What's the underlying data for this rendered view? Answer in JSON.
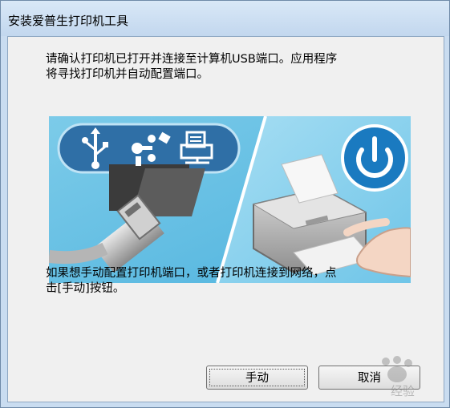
{
  "window": {
    "title": "安装爱普生打印机工具"
  },
  "content": {
    "message_top": "请确认打印机已打开并连接至计算机USB端口。应用程序\n将寻找打印机并自动配置端口。",
    "message_bottom": "如果想手动配置打印机端口，或者打印机连接到网络，点\n击[手动]按钮。"
  },
  "illustration": {
    "icons": [
      "usb-icon",
      "firewire-icon",
      "network-printer-icon",
      "power-icon"
    ],
    "colors": {
      "left_panel": "#6ec6e6",
      "right_panel": "#8dd3ee",
      "icon_pill": "#2f6fa6",
      "power_circle": "#1a7ac0"
    }
  },
  "buttons": {
    "manual_label": "手动",
    "cancel_label": "取消"
  },
  "watermark": {
    "text": "经验"
  }
}
